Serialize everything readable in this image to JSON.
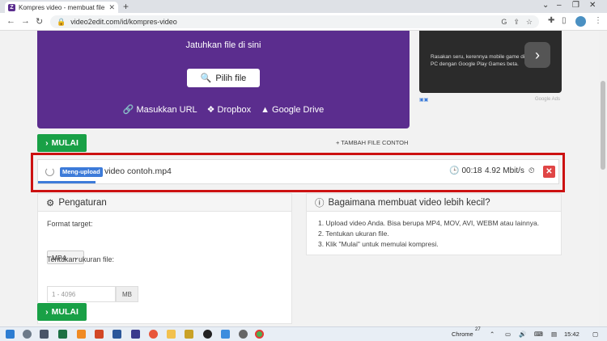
{
  "browser": {
    "tab_title": "Kompres video - membuat file vi",
    "new_tab": "+",
    "url": "video2edit.com/id/kompres-video"
  },
  "upload": {
    "drop_text": "Jatuhkan file di sini",
    "pick_button": "Pilih file",
    "source_url": "Masukkan URL",
    "source_dropbox": "Dropbox",
    "source_drive": "Google Drive"
  },
  "ad": {
    "text": "Rasakan seru, kerennya mobile game di PC dengan Google Play Games beta.",
    "footer": "Google Ads"
  },
  "actions": {
    "start_label": "MULAI",
    "sample_label": "TAMBAH FILE CONTOH"
  },
  "file_row": {
    "status_badge": "Meng-upload",
    "file_name": "video contoh.mp4",
    "elapsed": "00:18",
    "speed": "4.92 Mbit/s",
    "progress": 0.11
  },
  "settings": {
    "title": "Pengaturan",
    "format_label": "Format target:",
    "format_value": "MP4",
    "size_label": "Tentukan ukuran file:",
    "size_placeholder": "1 - 4096",
    "size_unit": "MB"
  },
  "help": {
    "title": "Bagaimana membuat video lebih kecil?",
    "steps": [
      "1. Upload video Anda. Bisa berupa MP4, MOV, AVI, WEBM atau lainnya.",
      "2. Tentukan ukuran file.",
      "3. Klik \"Mulai\" untuk memulai kompresi."
    ]
  },
  "taskbar": {
    "tray_app": "Chrome",
    "tray_temp": "27",
    "clock": "15:42"
  },
  "colors": {
    "brand_purple": "#5b2d8e",
    "start_green": "#19a046",
    "badge_blue": "#3d7bd9",
    "highlight_red": "#cc1111"
  }
}
